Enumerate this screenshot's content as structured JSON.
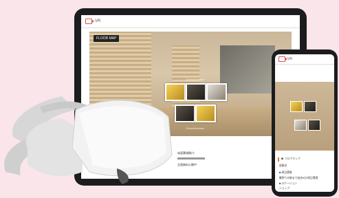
{
  "tablet": {
    "title": "VR",
    "floor_map": "FLOOR MAP",
    "overlay_caption": "Shimokitazawa",
    "overlay_small": "Shimokitazawa",
    "content_heading": "床面積/間取り",
    "content_sub": "全面無料公開中"
  },
  "phone": {
    "title": "VR",
    "rows": [
      {
        "label": "▶ フロアマップ"
      },
      {
        "label": "部屋名"
      },
      {
        "label": "■ 周辺環境"
      },
      {
        "label": "最寄りの駅まで徒歩5分/周辺環境"
      },
      {
        "label": "■ ロケーション"
      },
      {
        "label": "ショップ"
      }
    ]
  },
  "colors": {
    "background": "#f9e5ea",
    "accent": "#d9534f",
    "headset": "#eeeeee"
  },
  "icons": [
    "vr-camera-icon"
  ]
}
